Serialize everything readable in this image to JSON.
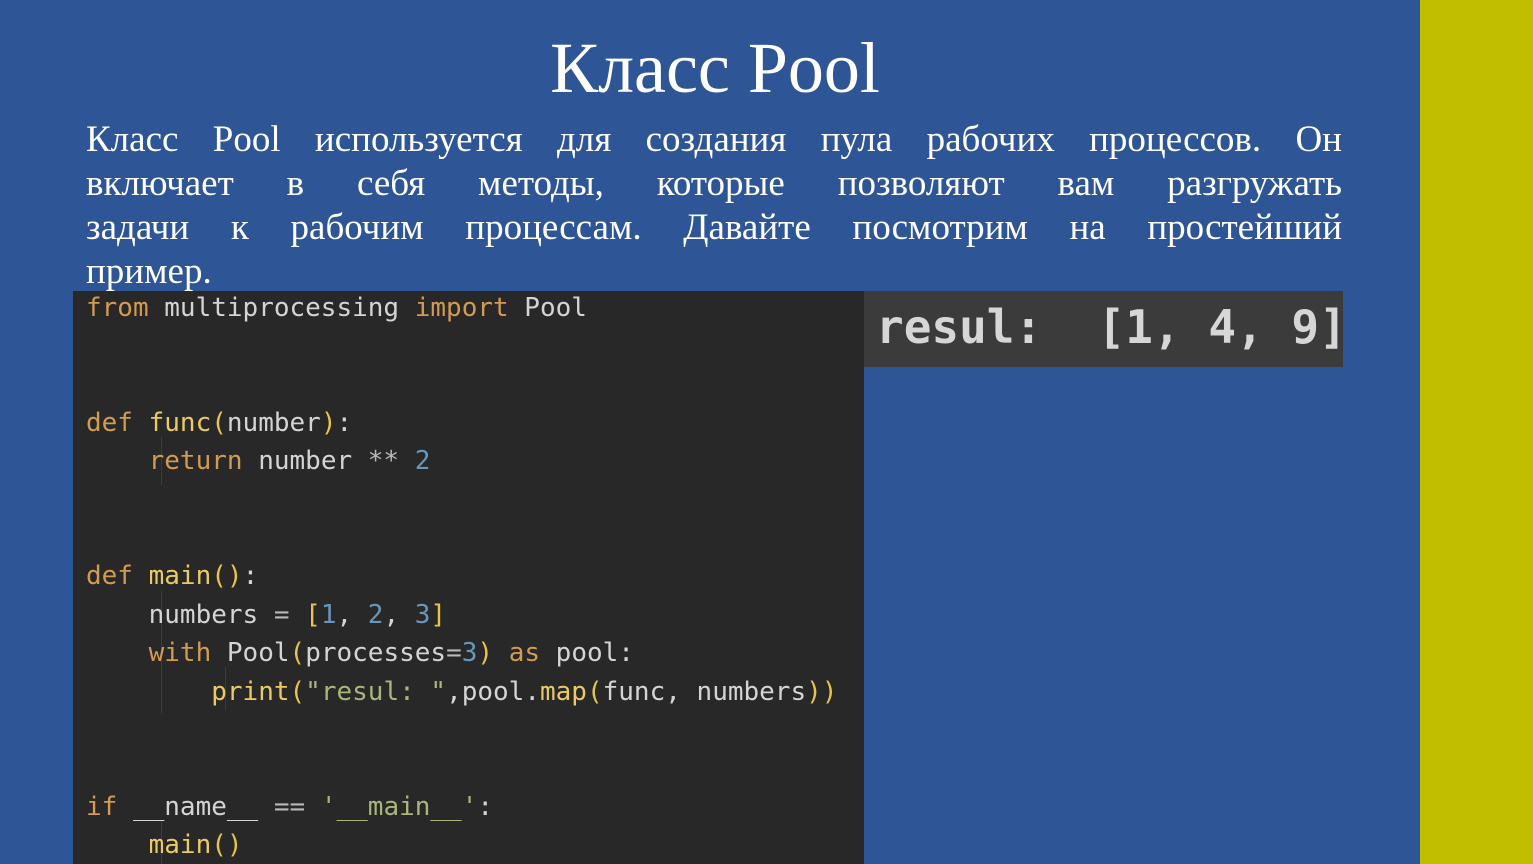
{
  "title": "Класс Pool",
  "body_lines": [
    "Класс Pool используется для создания пула рабочих процессов. Он",
    "включает в себя методы, которые позволяют вам разгружать",
    "задачи к рабочим процессам. Давайте посмотрим на простейший",
    "пример."
  ],
  "code": {
    "line1": {
      "t1": "from",
      "t2": " multiprocessing ",
      "t3": "import",
      "t4": " Pool"
    },
    "line2": {
      "t1": "def",
      "t2": " ",
      "t3": "func",
      "t4": "(",
      "t5": "number",
      "t6": ")",
      "t7": ":"
    },
    "line3": {
      "t1": "    ",
      "t2": "return",
      "t3": " number ",
      "t4": "**",
      "t5": " ",
      "t6": "2"
    },
    "line4": {
      "t1": "def",
      "t2": " ",
      "t3": "main",
      "t4": "()",
      "t5": ":"
    },
    "line5": {
      "t1": "    numbers ",
      "t2": "=",
      "t3": " ",
      "t4": "[",
      "t5": "1",
      "t6": ", ",
      "t7": "2",
      "t8": ", ",
      "t9": "3",
      "t10": "]"
    },
    "line6": {
      "t1": "    ",
      "t2": "with",
      "t3": " Pool",
      "t4": "(",
      "t5": "processes",
      "t6": "=",
      "t7": "3",
      "t8": ")",
      "t9": " ",
      "t10": "as",
      "t11": " pool:"
    },
    "line7": {
      "t1": "        ",
      "t2": "print",
      "t3": "(",
      "t4": "\"resul: \"",
      "t5": ",pool.",
      "t6": "map",
      "t7": "(",
      "t8": "func",
      "t9": ", numbers",
      "t10": ")",
      "t11": ")"
    },
    "line8": {
      "t1": "if",
      "t2": " __name__ ",
      "t3": "==",
      "t4": " ",
      "t5": "'__main__'",
      "t6": ":"
    },
    "line9": {
      "t1": "    ",
      "t2": "main",
      "t3": "()"
    }
  },
  "output": "resul:  [1, 4, 9]",
  "colors": {
    "background": "#2E5596",
    "accent_bar": "#C1BE00",
    "code_background": "#282828",
    "output_background": "#3B3B3B",
    "keyword": "#D29A52",
    "function": "#EACB63",
    "number": "#6897BB",
    "string": "#A8B67A"
  }
}
